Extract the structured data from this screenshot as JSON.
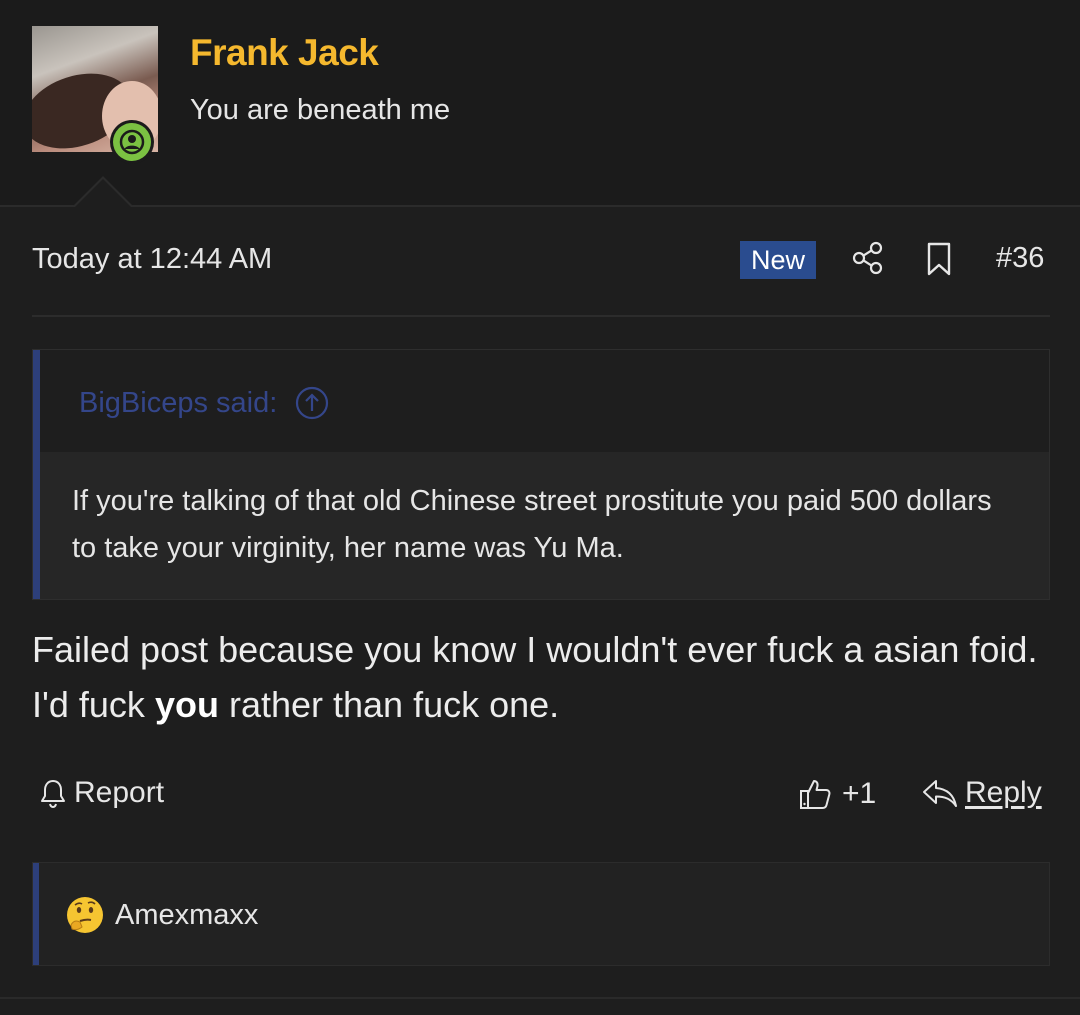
{
  "user": {
    "name": "Frank Jack",
    "title": "You are beneath me",
    "online": true
  },
  "post": {
    "timestamp": "Today at 12:44 AM",
    "new_badge": "New",
    "number": "#36"
  },
  "quote": {
    "author": "BigBiceps said:",
    "text": "If you're talking of that old Chinese street prostitute you paid 500 dollars to take your virginity, her name was Yu Ma."
  },
  "message": {
    "part1": "Failed post because you know I wouldn't ever fuck a asian foid. I'd fuck ",
    "bold": "you",
    "part2": " rather than fuck one."
  },
  "actions": {
    "report_label": "Report",
    "like_count": "+1",
    "reply_label": "Reply"
  },
  "reactions": {
    "users": "Amexmaxx",
    "emoji": "thinking-face-icon"
  },
  "colors": {
    "background": "#1e1e1e",
    "username": "#f5b82e",
    "new_badge": "#2a4c8f",
    "quote_accent": "#2d3f7a",
    "online_badge": "#7bc142"
  }
}
